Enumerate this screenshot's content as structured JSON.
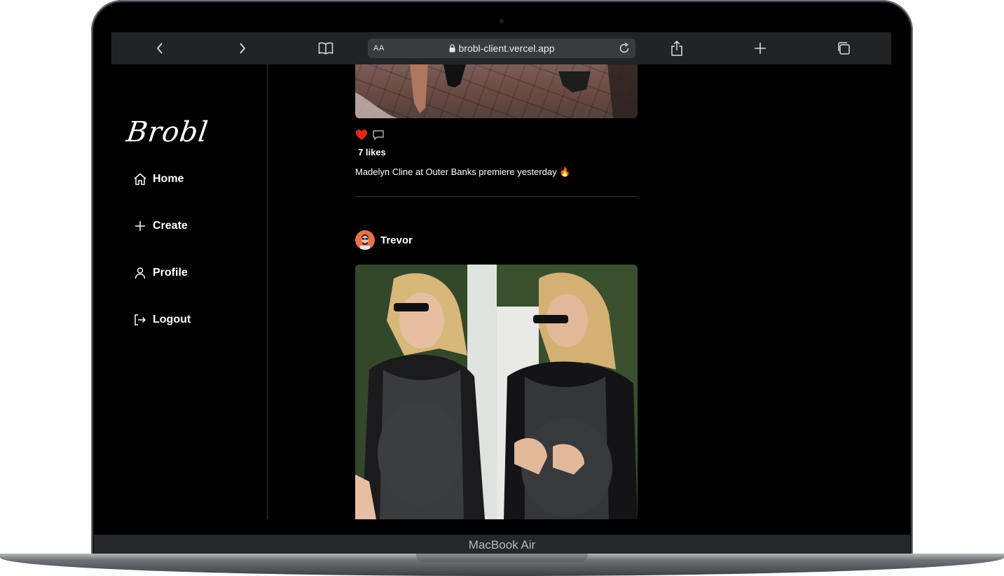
{
  "device": {
    "label": "MacBook Air"
  },
  "browser": {
    "aa_label": "AA",
    "url": "brobl-client.vercel.app"
  },
  "app": {
    "logo": "Brobl",
    "nav": [
      {
        "label": "Home",
        "icon": "home-icon"
      },
      {
        "label": "Create",
        "icon": "plus-icon"
      },
      {
        "label": "Profile",
        "icon": "user-icon"
      },
      {
        "label": "Logout",
        "icon": "logout-icon"
      }
    ]
  },
  "feed": {
    "posts": [
      {
        "likes": "7 likes",
        "caption": "Madelyn Cline at Outer Banks premiere yesterday 🔥",
        "liked": true
      },
      {
        "author": "Trevor"
      }
    ]
  },
  "colors": {
    "like_red": "#e0261b",
    "toolbar_bg": "#222324",
    "page_bg": "#000000"
  }
}
